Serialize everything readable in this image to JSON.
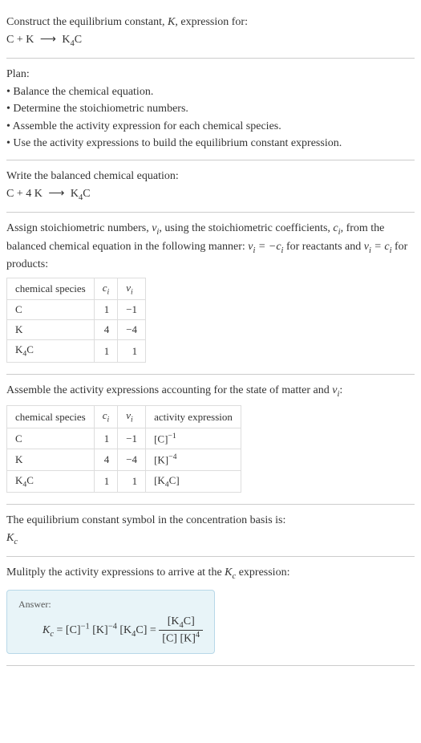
{
  "header": {
    "prompt_line1": "Construct the equilibrium constant, ",
    "prompt_italic_K": "K",
    "prompt_line1_end": ", expression for:",
    "equation": "C + K ⟶ K₄C"
  },
  "plan": {
    "title": "Plan:",
    "bullet1": "• Balance the chemical equation.",
    "bullet2": "• Determine the stoichiometric numbers.",
    "bullet3": "• Assemble the activity expression for each chemical species.",
    "bullet4": "• Use the activity expressions to build the equilibrium constant expression."
  },
  "balanced": {
    "title": "Write the balanced chemical equation:",
    "equation": "C + 4 K ⟶ K₄C"
  },
  "stoich": {
    "intro1": "Assign stoichiometric numbers, ",
    "nu_i": "νᵢ",
    "intro2": ", using the stoichiometric coefficients, ",
    "c_i": "cᵢ",
    "intro3": ", from the balanced chemical equation in the following manner: ",
    "rule1": "νᵢ = −cᵢ",
    "intro4": " for reactants and ",
    "rule2": "νᵢ = cᵢ",
    "intro5": " for products:",
    "table": {
      "headers": [
        "chemical species",
        "cᵢ",
        "νᵢ"
      ],
      "rows": [
        [
          "C",
          "1",
          "−1"
        ],
        [
          "K",
          "4",
          "−4"
        ],
        [
          "K₄C",
          "1",
          "1"
        ]
      ]
    }
  },
  "activity": {
    "intro1": "Assemble the activity expressions accounting for the state of matter and ",
    "nu_i": "νᵢ",
    "intro2": ":",
    "table": {
      "headers": [
        "chemical species",
        "cᵢ",
        "νᵢ",
        "activity expression"
      ],
      "rows": [
        [
          "C",
          "1",
          "−1",
          "[C]⁻¹"
        ],
        [
          "K",
          "4",
          "−4",
          "[K]⁻⁴"
        ],
        [
          "K₄C",
          "1",
          "1",
          "[K₄C]"
        ]
      ]
    }
  },
  "symbol": {
    "text": "The equilibrium constant symbol in the concentration basis is:",
    "value": "K_c"
  },
  "multiply": {
    "text1": "Mulitply the activity expressions to arrive at the ",
    "kc": "K_c",
    "text2": " expression:"
  },
  "answer": {
    "label": "Answer:",
    "lhs": "K_c",
    "equals": " = [C]⁻¹ [K]⁻⁴ [K₄C] = ",
    "frac_num": "[K₄C]",
    "frac_den": "[C] [K]⁴"
  }
}
